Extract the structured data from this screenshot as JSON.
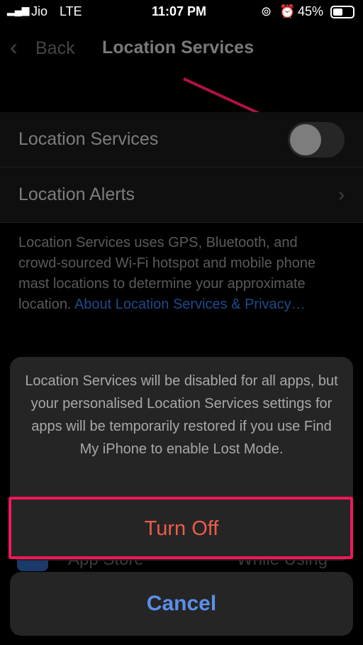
{
  "status_bar": {
    "carrier": "Jio",
    "network": "LTE",
    "time": "11:07 PM",
    "battery": "45%",
    "battery_level": 0.45
  },
  "nav": {
    "back_label": "Back",
    "title": "Location Services"
  },
  "settings": {
    "location_services": {
      "label": "Location Services",
      "enabled": false
    },
    "location_alerts": {
      "label": "Location Alerts"
    },
    "description": "Location Services uses GPS, Bluetooth, and crowd-sourced Wi-Fi hotspot and mobile phone mast locations to determine your approximate location.",
    "link": "About Location Services & Privacy…"
  },
  "background_row": {
    "app": "App Store",
    "value": "While Using"
  },
  "action_sheet": {
    "message": "Location Services will be disabled for all apps, but your personalised Location Services settings for apps will be temporarily restored if you use Find My iPhone to enable Lost Mode.",
    "turn_off_label": "Turn Off",
    "cancel_label": "Cancel"
  },
  "colors": {
    "destructive": "#ec5d4a",
    "cancel": "#5b8fe8",
    "highlight": "#f0185b"
  }
}
